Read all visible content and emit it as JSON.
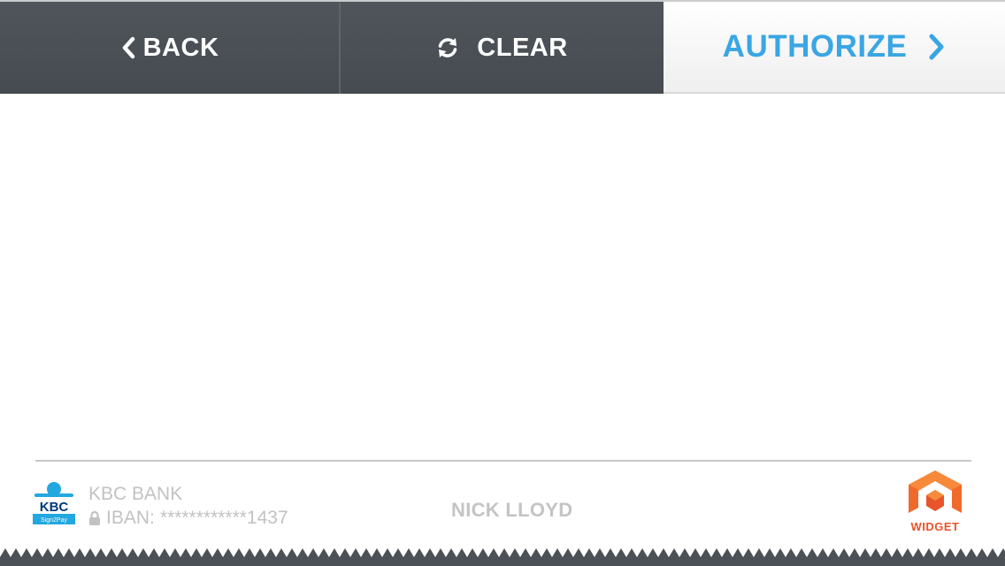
{
  "toolbar": {
    "back_label": "BACK",
    "clear_label": "CLEAR",
    "authorize_label": "AUTHORIZE",
    "icons": {
      "back": "chevron-left-icon",
      "clear": "refresh-icon",
      "authorize": "chevron-right-icon"
    }
  },
  "footer": {
    "bank_name": "KBC BANK",
    "iban_label": "IBAN:",
    "iban_value": "************1437",
    "holder_name": "NICK LLOYD",
    "kbc_logo_text": "KBC",
    "kbc_logo_subtext": "Sign2Pay",
    "widget_label": "WIDGET"
  },
  "colors": {
    "toolbar_bg": "#4b5156",
    "accent": "#3aa6e3",
    "muted_text": "#c2c2c2",
    "widget_orange": "#e8542b"
  }
}
